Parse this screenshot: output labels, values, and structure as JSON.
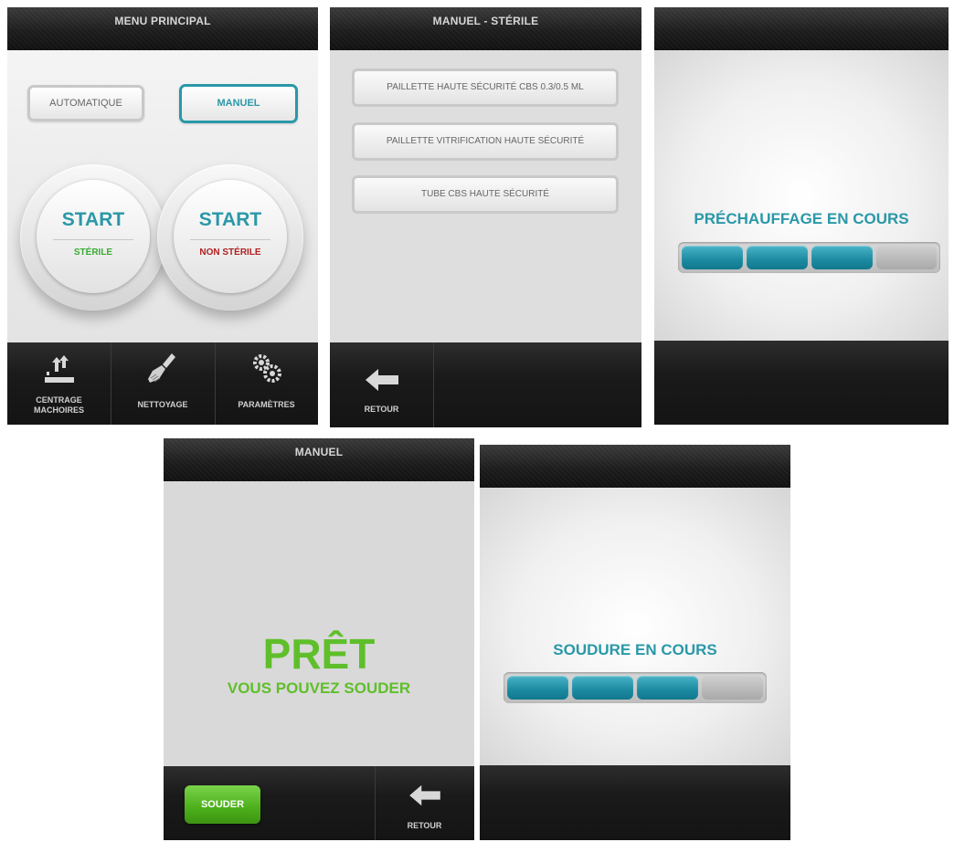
{
  "screen1": {
    "title": "MENU PRINCIPAL",
    "mode_auto": "AUTOMATIQUE",
    "mode_manual": "MANUEL",
    "start_left": {
      "label": "START",
      "sub": "STÉRILE",
      "sub_color": "#3aaa35"
    },
    "start_right": {
      "label": "START",
      "sub": "NON STÉRILE",
      "sub_color": "#b02020"
    },
    "bottom": [
      {
        "label1": "CENTRAGE",
        "label2": "MACHOIRES",
        "icon": "centering-icon"
      },
      {
        "label1": "NETTOYAGE",
        "label2": "",
        "icon": "brush-icon"
      },
      {
        "label1": "PARAMÈTRES",
        "label2": "",
        "icon": "gears-icon"
      }
    ]
  },
  "screen2": {
    "title": "MANUEL - STÉRILE",
    "items": [
      "PAILLETTE HAUTE SÉCURITÉ CBS 0.3/0.5 ML",
      "PAILLETTE VITRIFICATION HAUTE SÉCURITÉ",
      "TUBE CBS HAUTE SÉCURITÉ"
    ],
    "back_label": "RETOUR"
  },
  "screen3": {
    "title": "",
    "status": "PRÉCHAUFFAGE EN COURS",
    "progress_segments_filled": 3,
    "progress_segments_total": 4
  },
  "screen4": {
    "title": "MANUEL",
    "ready_big": "PRÊT",
    "ready_sub": "VOUS POUVEZ SOUDER",
    "weld_button": "SOUDER",
    "back_label": "RETOUR"
  },
  "screen5": {
    "title": "",
    "status": "SOUDURE EN COURS",
    "progress_segments_filled": 3,
    "progress_segments_total": 4
  },
  "colors": {
    "accent_teal": "#2a98a8",
    "ready_green": "#5fbf2a",
    "weld_button_green": "#4caf1a"
  }
}
